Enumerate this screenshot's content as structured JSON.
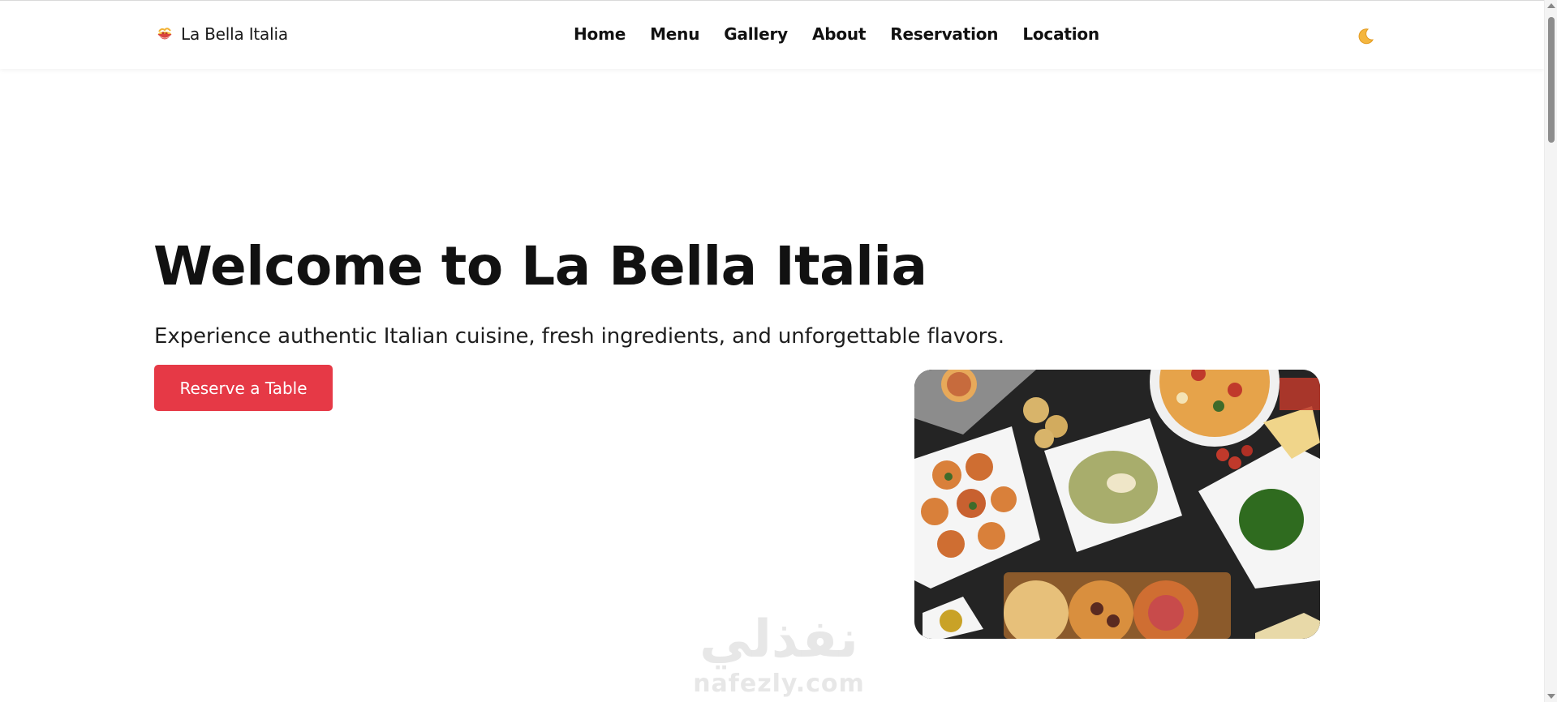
{
  "brand": {
    "name": "La Bella Italia",
    "icon": "spaghetti-bowl-icon"
  },
  "nav": {
    "links": [
      {
        "label": "Home"
      },
      {
        "label": "Menu"
      },
      {
        "label": "Gallery"
      },
      {
        "label": "About"
      },
      {
        "label": "Reservation"
      },
      {
        "label": "Location"
      }
    ],
    "theme_toggle_icon": "crescent-moon-icon"
  },
  "hero": {
    "title": "Welcome to La Bella Italia",
    "subtitle": "Experience authentic Italian cuisine, fresh ingredients, and unforgettable flavors.",
    "cta_label": "Reserve a Table",
    "image_icon": "italian-food-spread-image"
  },
  "watermark": {
    "arabic": "نفذلي",
    "latin": "nafezly.com"
  },
  "colors": {
    "accent": "#e63946",
    "text": "#111111",
    "background": "#ffffff"
  }
}
